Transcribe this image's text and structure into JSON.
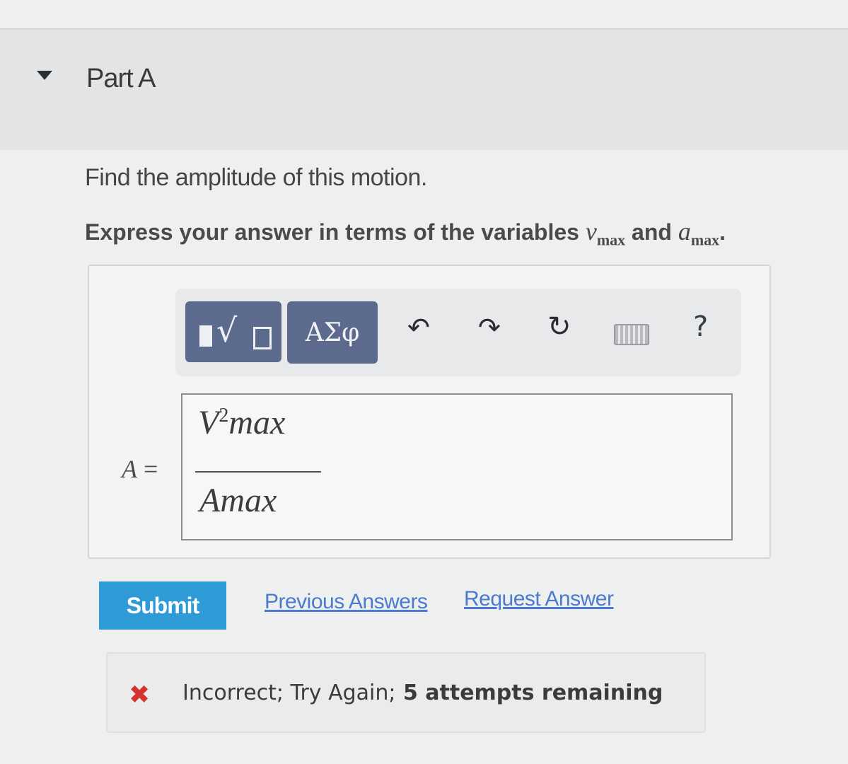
{
  "part": {
    "title": "Part A"
  },
  "question": {
    "text": "Find the amplitude of this motion.",
    "instruction_prefix": "Express your answer in terms of the variables ",
    "var1": "v",
    "var1_sub": "max",
    "and": " and ",
    "var2": "a",
    "var2_sub": "max",
    "instruction_suffix": "."
  },
  "toolbar": {
    "symbols_label": "ΑΣφ",
    "undo_glyph": "↶",
    "redo_glyph": "↷",
    "reset_glyph": "↻",
    "help_label": "?"
  },
  "answer": {
    "label": "A",
    "equals": " =",
    "numerator": "V",
    "numerator_sup": "2",
    "numerator_rest": "max",
    "denominator": "Amax"
  },
  "actions": {
    "submit_label": "Submit",
    "previous_answers": "Previous Answers",
    "request_answer": "Request Answer"
  },
  "feedback": {
    "icon": "✖",
    "status": "Incorrect; Try Again;",
    "attempts": " 5 attempts remaining"
  },
  "colors": {
    "submit": "#2e9ad6",
    "toolbar_button": "#5c6a8e",
    "link": "#4a7bd0",
    "error": "#d73232"
  }
}
